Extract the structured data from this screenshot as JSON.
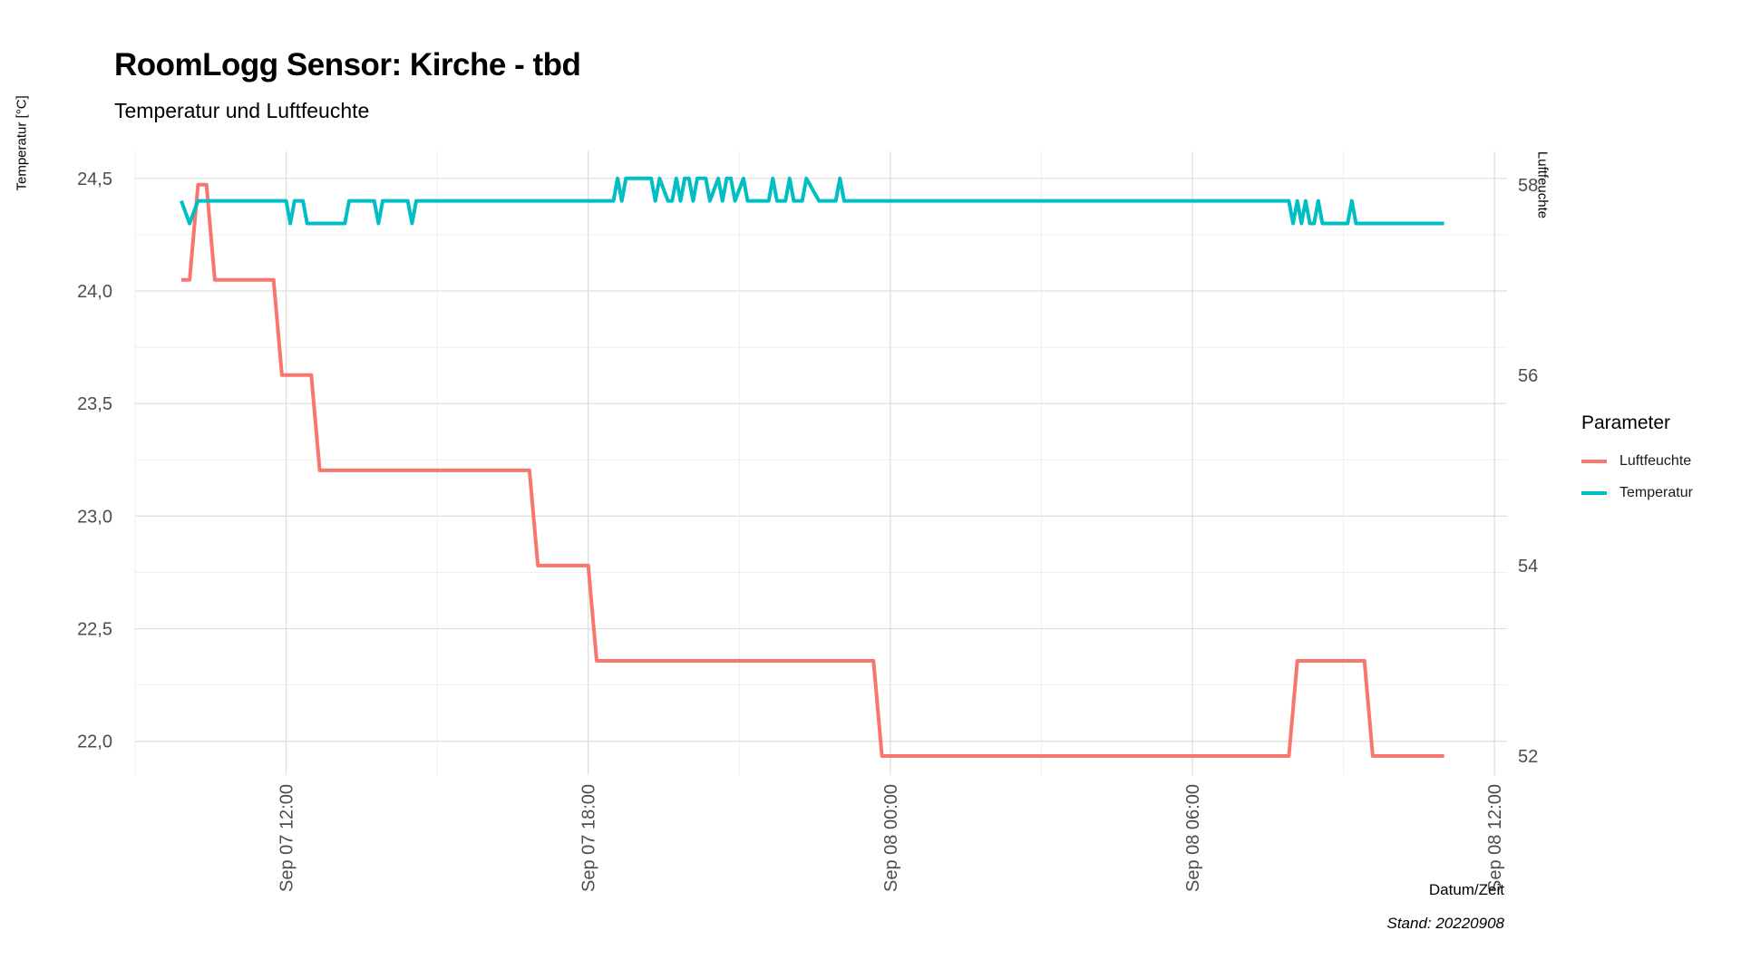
{
  "colors": {
    "luftfeuchte": "#F8766D",
    "temperatur": "#00BFC4",
    "grid_major": "#dddddd",
    "grid_minor": "#ebebeb"
  },
  "chart_data": {
    "type": "line",
    "title": "RoomLogg Sensor: Kirche - tbd",
    "subtitle": "Temperatur und Luftfeuchte",
    "xlabel": "Datum/Zeit",
    "ylabel_left": "Temperatur [°C]",
    "ylabel_right": "Luftfeuchte",
    "caption": "Stand: 20220908",
    "legend_title": "Parameter",
    "legend_position": "right",
    "grid": true,
    "x_tick_labels": [
      "Sep 07 12:00",
      "Sep 07 18:00",
      "Sep 08 00:00",
      "Sep 08 06:00",
      "Sep 08 12:00"
    ],
    "x_ticks": [
      "2022-09-07 12:00",
      "2022-09-07 18:00",
      "2022-09-08 00:00",
      "2022-09-08 06:00",
      "2022-09-08 12:00"
    ],
    "xlim": [
      "2022-09-07 09:00",
      "2022-09-08 12:15"
    ],
    "y_left_ticks": [
      "22,0",
      "22,5",
      "23,0",
      "23,5",
      "24,0",
      "24,5"
    ],
    "ylim_left": [
      21.85,
      24.62
    ],
    "y_right_ticks": [
      "52",
      "54",
      "56",
      "58"
    ],
    "ylim_right": [
      51.8,
      58.35
    ],
    "series": [
      {
        "name": "Luftfeuchte",
        "axis": "right",
        "x": [
          "2022-09-07 09:55",
          "2022-09-07 10:05",
          "2022-09-07 10:15",
          "2022-09-07 10:25",
          "2022-09-07 10:35",
          "2022-09-07 11:45",
          "2022-09-07 11:55",
          "2022-09-07 12:30",
          "2022-09-07 12:40",
          "2022-09-07 16:50",
          "2022-09-07 17:00",
          "2022-09-07 18:00",
          "2022-09-07 18:10",
          "2022-09-07 23:40",
          "2022-09-07 23:50",
          "2022-09-08 07:55",
          "2022-09-08 08:05",
          "2022-09-08 09:25",
          "2022-09-08 09:35",
          "2022-09-08 11:00"
        ],
        "y": [
          57.0,
          57.0,
          58.0,
          58.0,
          57.0,
          57.0,
          56.0,
          56.0,
          55.0,
          55.0,
          54.0,
          54.0,
          53.0,
          53.0,
          52.0,
          52.0,
          53.0,
          53.0,
          52.0,
          52.0
        ]
      },
      {
        "name": "Temperatur",
        "axis": "left",
        "x": [
          "2022-09-07 09:55",
          "2022-09-07 10:05",
          "2022-09-07 10:15",
          "2022-09-07 12:00",
          "2022-09-07 12:05",
          "2022-09-07 12:10",
          "2022-09-07 12:20",
          "2022-09-07 12:25",
          "2022-09-07 13:10",
          "2022-09-07 13:15",
          "2022-09-07 13:45",
          "2022-09-07 13:50",
          "2022-09-07 13:55",
          "2022-09-07 14:25",
          "2022-09-07 14:30",
          "2022-09-07 14:35",
          "2022-09-07 18:30",
          "2022-09-07 18:35",
          "2022-09-07 18:40",
          "2022-09-07 18:45",
          "2022-09-07 19:15",
          "2022-09-07 19:20",
          "2022-09-07 19:25",
          "2022-09-07 19:35",
          "2022-09-07 19:40",
          "2022-09-07 19:45",
          "2022-09-07 19:50",
          "2022-09-07 19:55",
          "2022-09-07 20:00",
          "2022-09-07 20:05",
          "2022-09-07 20:10",
          "2022-09-07 20:20",
          "2022-09-07 20:25",
          "2022-09-07 20:35",
          "2022-09-07 20:40",
          "2022-09-07 20:45",
          "2022-09-07 20:50",
          "2022-09-07 20:55",
          "2022-09-07 21:05",
          "2022-09-07 21:10",
          "2022-09-07 21:15",
          "2022-09-07 21:20",
          "2022-09-07 21:35",
          "2022-09-07 21:40",
          "2022-09-07 21:45",
          "2022-09-07 21:55",
          "2022-09-07 22:00",
          "2022-09-07 22:05",
          "2022-09-07 22:10",
          "2022-09-07 22:15",
          "2022-09-07 22:20",
          "2022-09-07 22:35",
          "2022-09-07 22:40",
          "2022-09-07 22:45",
          "2022-09-07 22:55",
          "2022-09-07 23:00",
          "2022-09-07 23:05",
          "2022-09-08 07:55",
          "2022-09-08 08:00",
          "2022-09-08 08:05",
          "2022-09-08 08:10",
          "2022-09-08 08:15",
          "2022-09-08 08:20",
          "2022-09-08 08:25",
          "2022-09-08 08:30",
          "2022-09-08 08:35",
          "2022-09-08 08:40",
          "2022-09-08 08:45",
          "2022-09-08 09:05",
          "2022-09-08 09:10",
          "2022-09-08 09:15",
          "2022-09-08 11:00"
        ],
        "y": [
          24.4,
          24.3,
          24.4,
          24.4,
          24.3,
          24.4,
          24.4,
          24.3,
          24.3,
          24.4,
          24.4,
          24.3,
          24.4,
          24.4,
          24.3,
          24.4,
          24.4,
          24.5,
          24.4,
          24.5,
          24.5,
          24.4,
          24.5,
          24.4,
          24.4,
          24.5,
          24.4,
          24.5,
          24.5,
          24.4,
          24.5,
          24.5,
          24.4,
          24.5,
          24.4,
          24.5,
          24.5,
          24.4,
          24.5,
          24.4,
          24.4,
          24.4,
          24.4,
          24.5,
          24.4,
          24.4,
          24.5,
          24.4,
          24.4,
          24.4,
          24.5,
          24.4,
          24.4,
          24.4,
          24.4,
          24.5,
          24.4,
          24.4,
          24.3,
          24.4,
          24.3,
          24.4,
          24.3,
          24.3,
          24.4,
          24.3,
          24.3,
          24.3,
          24.3,
          24.4,
          24.3,
          24.3
        ]
      }
    ]
  }
}
